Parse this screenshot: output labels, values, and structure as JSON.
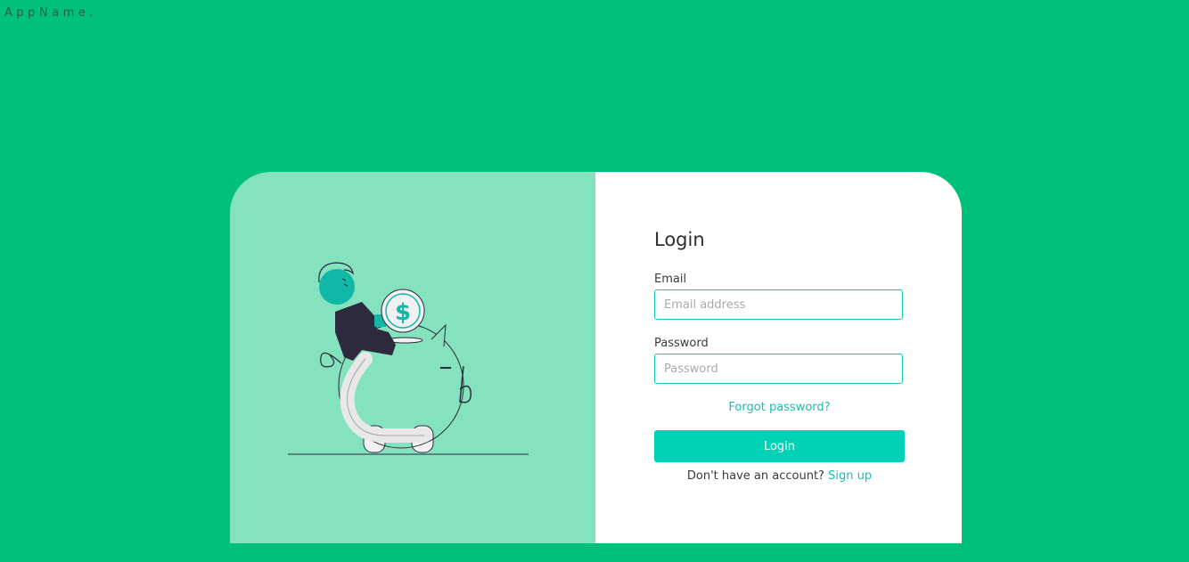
{
  "app": {
    "brand": "AppName."
  },
  "login": {
    "title": "Login",
    "email_label": "Email",
    "email_placeholder": "Email address",
    "email_value": "",
    "password_label": "Password",
    "password_placeholder": "Password",
    "password_value": "",
    "forgot_label": "Forgot password?",
    "submit_label": "Login",
    "no_account_text": "Don't have an account?",
    "signup_label": "Sign up"
  },
  "illustration": {
    "name": "piggy-bank-illustration",
    "coin_symbol": "$"
  },
  "colors": {
    "background": "#00c17c",
    "illustration_panel": "#84e2be",
    "accent": "#00d3b5",
    "link": "#1bbfae",
    "input_border": "#14c6b3"
  }
}
